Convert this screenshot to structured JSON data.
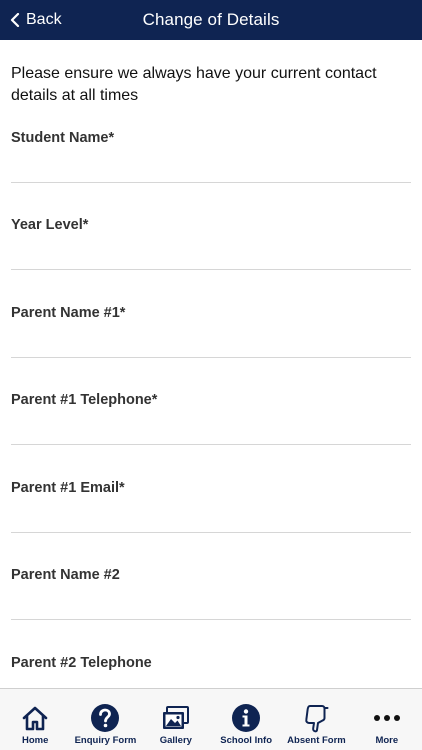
{
  "header": {
    "back_label": "Back",
    "title": "Change of Details",
    "background_color": "#0f2452"
  },
  "form": {
    "intro": "Please ensure we always have your current contact details at all times",
    "fields": [
      {
        "label": "Student Name*",
        "value": ""
      },
      {
        "label": "Year Level*",
        "value": ""
      },
      {
        "label": "Parent Name #1*",
        "value": ""
      },
      {
        "label": "Parent #1 Telephone*",
        "value": ""
      },
      {
        "label": "Parent #1 Email*",
        "value": ""
      },
      {
        "label": "Parent Name #2",
        "value": ""
      },
      {
        "label": "Parent #2 Telephone",
        "value": ""
      }
    ]
  },
  "tabbar": {
    "accent_color": "#0f2452",
    "tabs": [
      {
        "label": "Home",
        "icon": "home-icon"
      },
      {
        "label": "Enquiry Form",
        "icon": "question-icon"
      },
      {
        "label": "Gallery",
        "icon": "gallery-icon"
      },
      {
        "label": "School Info",
        "icon": "info-icon"
      },
      {
        "label": "Absent Form",
        "icon": "thumbs-down-icon"
      },
      {
        "label": "More",
        "icon": "more-icon"
      }
    ]
  }
}
